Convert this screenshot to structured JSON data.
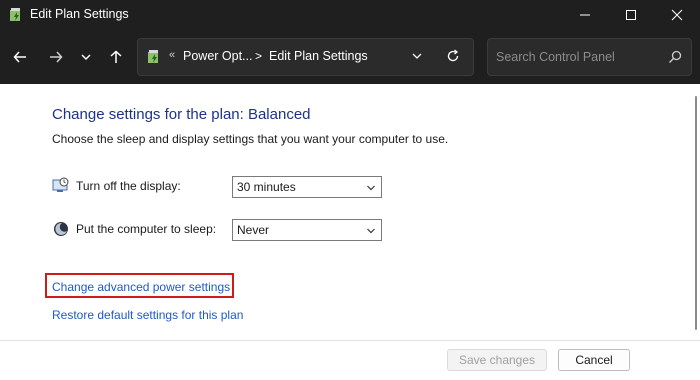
{
  "window": {
    "title": "Edit Plan Settings",
    "icon": "power-options-icon"
  },
  "nav": {
    "breadcrumb_prefix": "«",
    "breadcrumb_1": "Power Opt...",
    "breadcrumb_sep": ">",
    "breadcrumb_2": "Edit Plan Settings",
    "search_placeholder": "Search Control Panel"
  },
  "main": {
    "heading": "Change settings for the plan: Balanced",
    "description": "Choose the sleep and display settings that you want your computer to use.",
    "settings": [
      {
        "label": "Turn off the display:",
        "value": "30 minutes",
        "icon": "display-icon"
      },
      {
        "label": "Put the computer to sleep:",
        "value": "Never",
        "icon": "sleep-moon-icon"
      }
    ],
    "links": {
      "advanced": "Change advanced power settings",
      "restore": "Restore default settings for this plan"
    }
  },
  "footer": {
    "save_label": "Save changes",
    "cancel_label": "Cancel"
  },
  "colors": {
    "heading": "#1e3287",
    "link": "#1f5ac8",
    "highlight_border": "#d11b1b",
    "titlebar": "#1f1f1f"
  }
}
